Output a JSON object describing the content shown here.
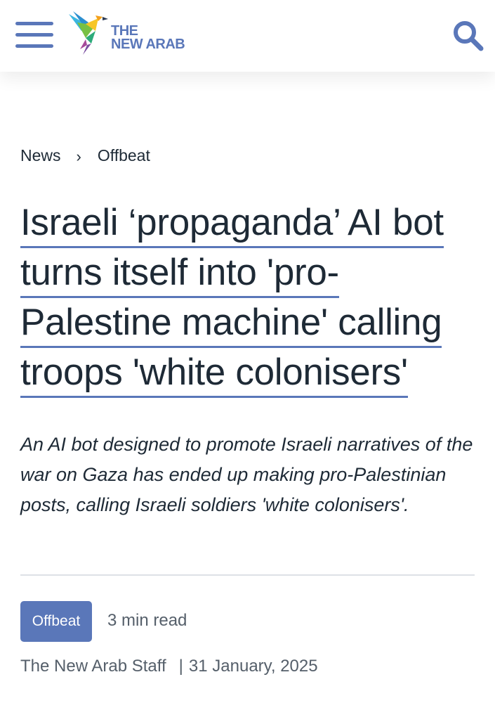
{
  "header": {
    "logo": {
      "line1": "THE",
      "line2": "NEW ARAB",
      "icon": "hummingbird-logo-icon"
    },
    "menu_icon": "hamburger-menu-icon",
    "search_icon": "search-icon",
    "accent_color": "#5a77b9"
  },
  "breadcrumb": {
    "items": [
      "News",
      "Offbeat"
    ],
    "separator": "›"
  },
  "article": {
    "headline_lines": [
      "Israeli ‘propaganda’ AI bot",
      "turns itself into 'pro-",
      "Palestine machine' calling",
      "troops 'white colonisers'"
    ],
    "standfirst": "An AI bot designed to promote Israeli narratives of the war on Gaza has ended up making pro-Palestinian posts, calling Israeli soldiers 'white colonisers'.",
    "tag": "Offbeat",
    "read_time": "3 min read",
    "author": "The New Arab Staff",
    "byline_separator": "|",
    "date": "31 January, 2025"
  }
}
